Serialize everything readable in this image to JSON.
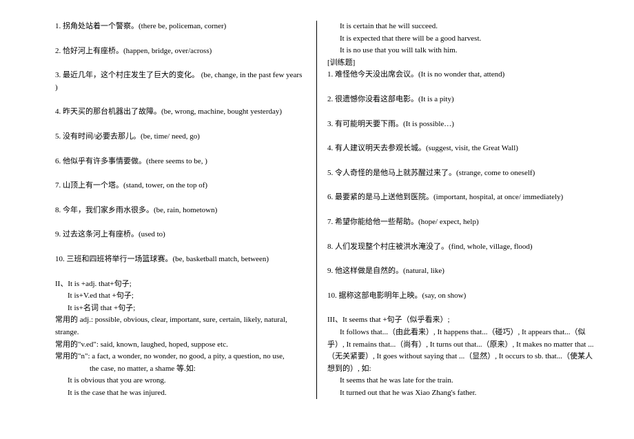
{
  "left": {
    "items": [
      "1. 拐角处站着一个警察。(there be, policeman, corner)",
      "2. 恰好河上有座桥。(happen, bridge, over/across)",
      "3. 最近几年，这个村庄发生了巨大的变化。 (be, change, in the past few years )",
      "4. 昨天买的那台机器出了故障。(be, wrong, machine, bought yesterday)",
      "5. 没有时间/必要去那儿。(be, time/ need, go)",
      "6. 他似乎有许多事情要做。(there seems to be, )",
      "7. 山顶上有一个塔。(stand, tower, on the top of)",
      "8. 今年，我们家乡雨水很多。(be, rain, hometown)",
      "9. 过去这条河上有座桥。(used to)",
      "10. 三班和四班将举行一场篮球赛。(be, basketball match, between)"
    ],
    "sec2": {
      "head": "II、It is +adj. that+句子;",
      "line2": "It is+V.ed that +句子;",
      "line3": "It is+名词 that  +句子;",
      "adj": "常用的 adj.: possible, obvious, clear, important, sure, certain, likely, natural, strange.",
      "ved": "常用的\"v.ed\": said, known, laughed, hoped, suppose etc.",
      "n": "常用的\"n\": a fact,  a wonder, no wonder, no good, a pity, a question, no use,",
      "ntail": "the case, no matter, a shame 等.如:",
      "ex1": "It is obvious that you are wrong.",
      "ex2": "It is the case that he was injured."
    }
  },
  "right": {
    "ex3": "It is certain that he will succeed.",
    "ex4": "It is expected that there will be a good harvest.",
    "ex5": "It is no use that you will talk with him.",
    "train": "[训练题]",
    "items": [
      "1. 难怪他今天没出席会议。(It is no wonder that, attend)",
      "2. 很遗憾你没看这部电影。(It is a pity)",
      "3. 有可能明天要下雨。(It is possible…)",
      "4. 有人建议明天去参观长城。(suggest, visit, the Great Wall)",
      "5. 令人奇怪的是他马上就苏醒过来了。(strange, come to oneself)",
      "6. 最要紧的是马上送他到医院。(important, hospital, at once/ immediately)",
      "7. 希望你能给他一些帮助。(hope/ expect, help)",
      "8. 人们发现整个村庄被洪水淹没了。(find, whole, village, flood)",
      "9. 他这样做是自然的。(natural, like)",
      "10. 据称这部电影明年上映。(say, on show)"
    ],
    "sec3": {
      "head": "III、It seems that +句子（似乎看来）;",
      "body": "It follows that...（由此看来）, It happens that...（碰巧）, It appears that...（似乎）, It remains that...（尚有）,  It turns out that...（原来）, It makes no matter that ...（无关紧要）,  It goes without saying that ...（显然）, It occurs to sb. that...（使某人想到的）, 如:",
      "ex1": "It seems that he was late for the train.",
      "ex2": "It turned out that he was Xiao Zhang's father."
    }
  }
}
